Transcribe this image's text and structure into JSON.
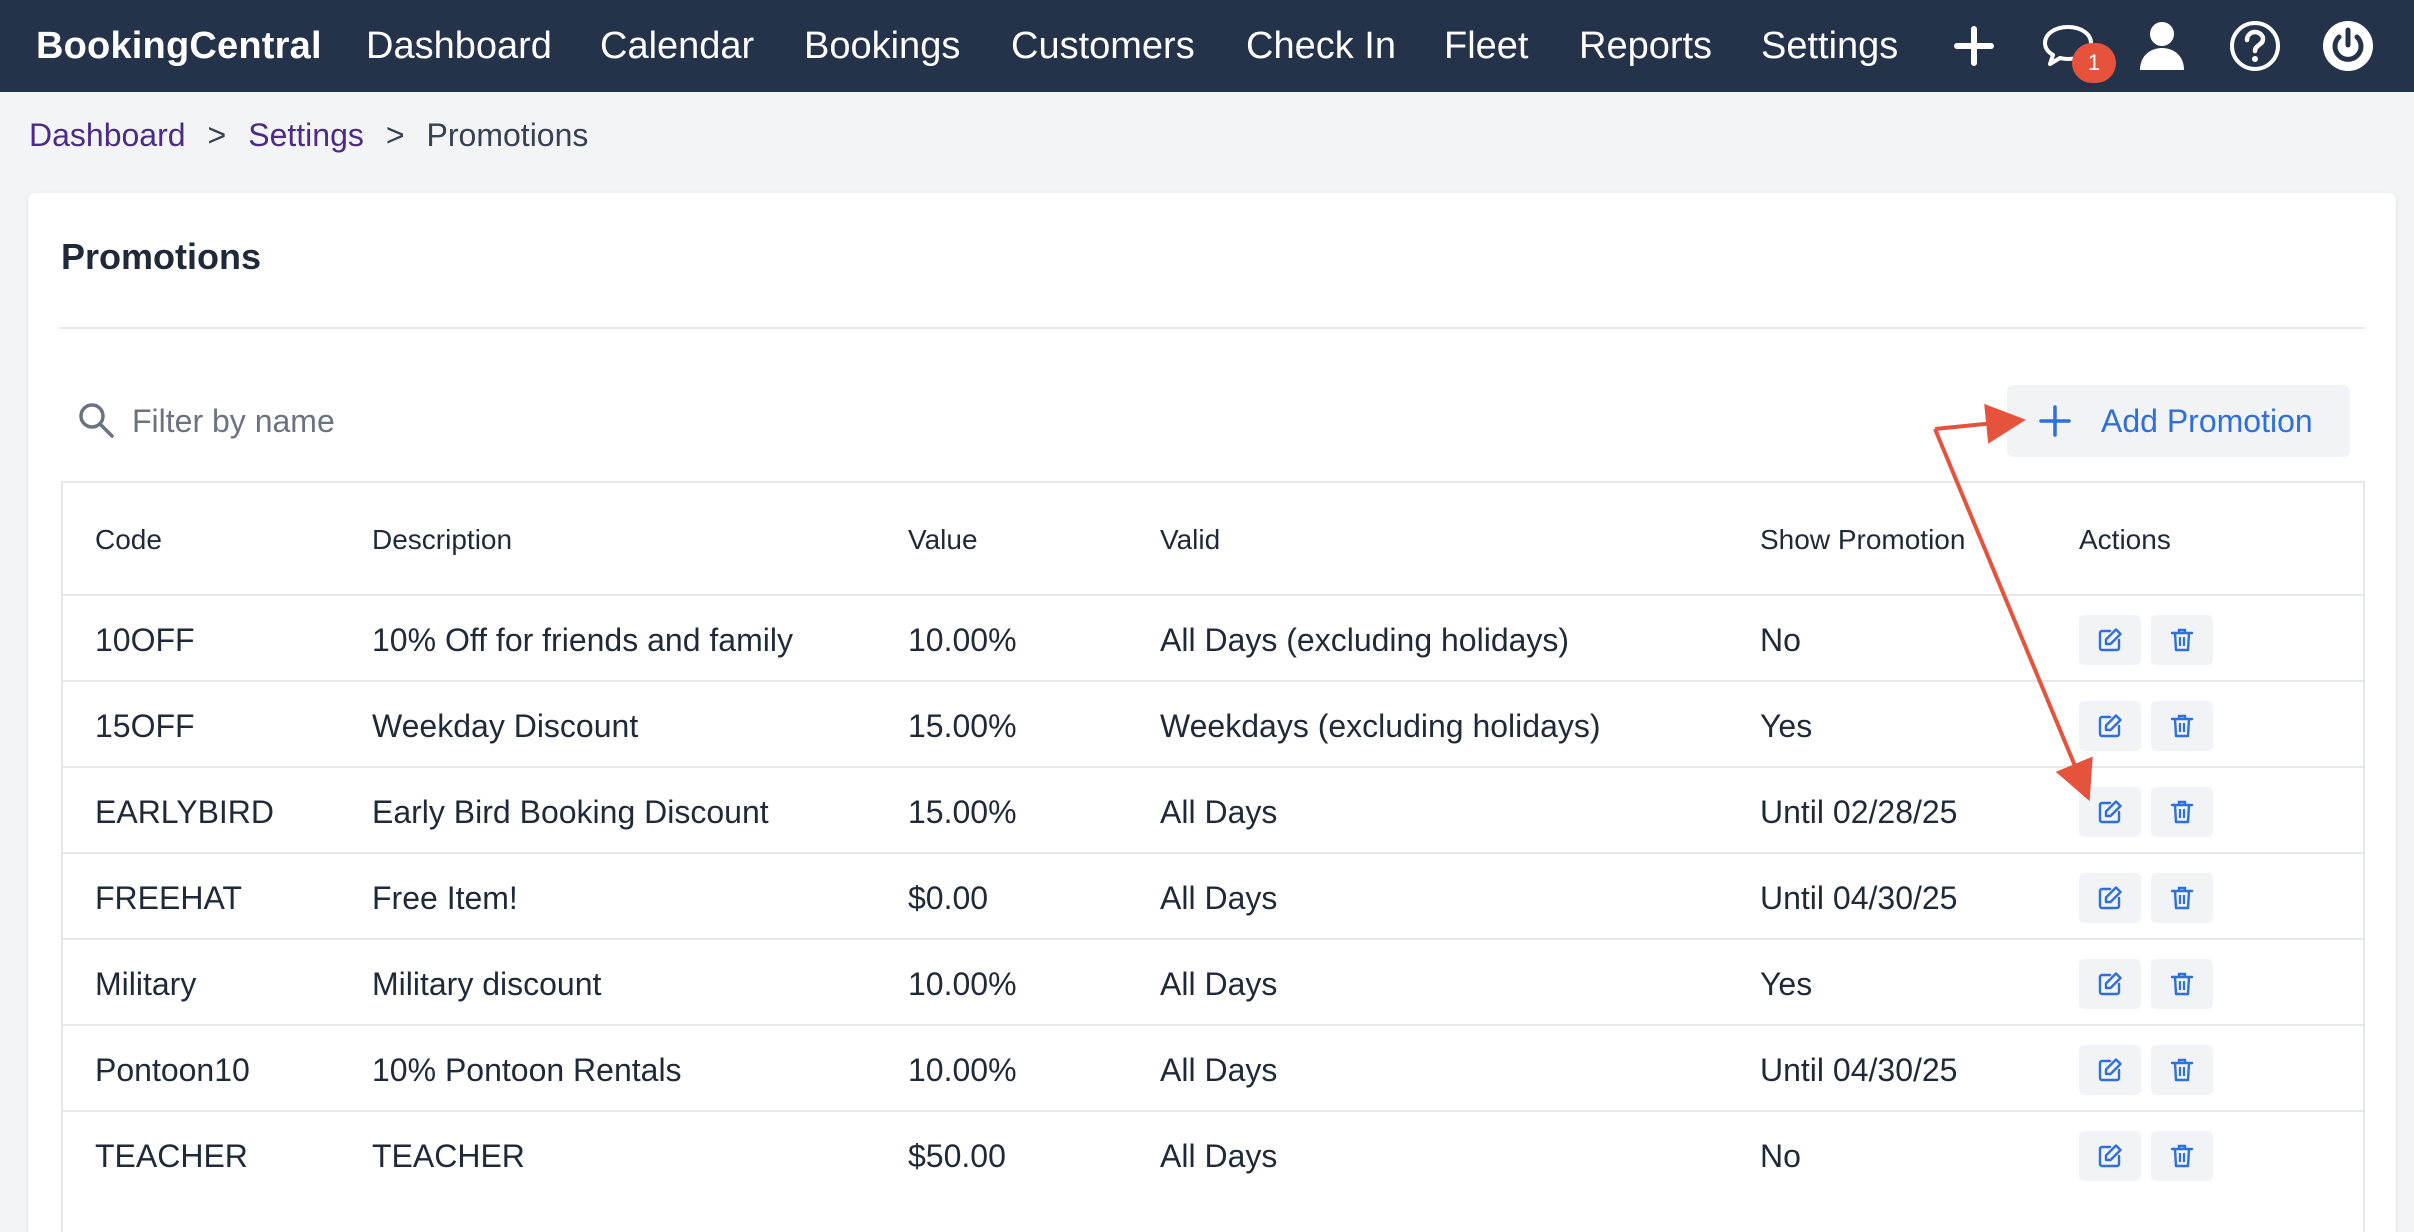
{
  "app": {
    "brand": "BookingCentral"
  },
  "nav": {
    "items": [
      {
        "label": "Dashboard"
      },
      {
        "label": "Calendar"
      },
      {
        "label": "Bookings"
      },
      {
        "label": "Customers"
      },
      {
        "label": "Check In"
      },
      {
        "label": "Fleet"
      },
      {
        "label": "Reports"
      },
      {
        "label": "Settings"
      }
    ],
    "icons": [
      "plus-icon",
      "chat-icon",
      "user-icon",
      "help-icon",
      "power-icon"
    ],
    "chat_badge": "1",
    "bar_color": "#24324a",
    "badge_color": "#e5533d"
  },
  "breadcrumb": {
    "items": [
      {
        "label": "Dashboard"
      },
      {
        "label": "Settings"
      },
      {
        "label": "Promotions"
      }
    ],
    "separator": ">",
    "link_color": "#4c2b86"
  },
  "page": {
    "title": "Promotions",
    "filter": {
      "placeholder": "Filter by name",
      "value": ""
    },
    "add_button": {
      "label": "Add Promotion",
      "icon": "plus-icon",
      "color": "#2f6fd9"
    }
  },
  "table": {
    "headers": {
      "code": "Code",
      "description": "Description",
      "value": "Value",
      "valid": "Valid",
      "show": "Show Promotion",
      "actions": "Actions"
    },
    "row_actions": [
      "edit-icon",
      "trash-icon"
    ],
    "rows": [
      {
        "code": "10OFF",
        "description": "10% Off for friends and family",
        "value": "10.00%",
        "valid": "All Days (excluding holidays)",
        "show": "No"
      },
      {
        "code": "15OFF",
        "description": "Weekday Discount",
        "value": "15.00%",
        "valid": "Weekdays (excluding holidays)",
        "show": "Yes"
      },
      {
        "code": "EARLYBIRD",
        "description": "Early Bird Booking Discount",
        "value": "15.00%",
        "valid": "All Days",
        "show": "Until 02/28/25"
      },
      {
        "code": "FREEHAT",
        "description": "Free Item!",
        "value": "$0.00",
        "valid": "All Days",
        "show": "Until 04/30/25"
      },
      {
        "code": "Military",
        "description": "Military discount",
        "value": "10.00%",
        "valid": "All Days",
        "show": "Yes"
      },
      {
        "code": "Pontoon10",
        "description": "10% Pontoon Rentals",
        "value": "10.00%",
        "valid": "All Days",
        "show": "Until 04/30/25"
      },
      {
        "code": "TEACHER",
        "description": "TEACHER",
        "value": "$50.00",
        "valid": "All Days",
        "show": "No"
      }
    ]
  },
  "annotation": {
    "type": "arrow",
    "color": "#e5533d"
  }
}
